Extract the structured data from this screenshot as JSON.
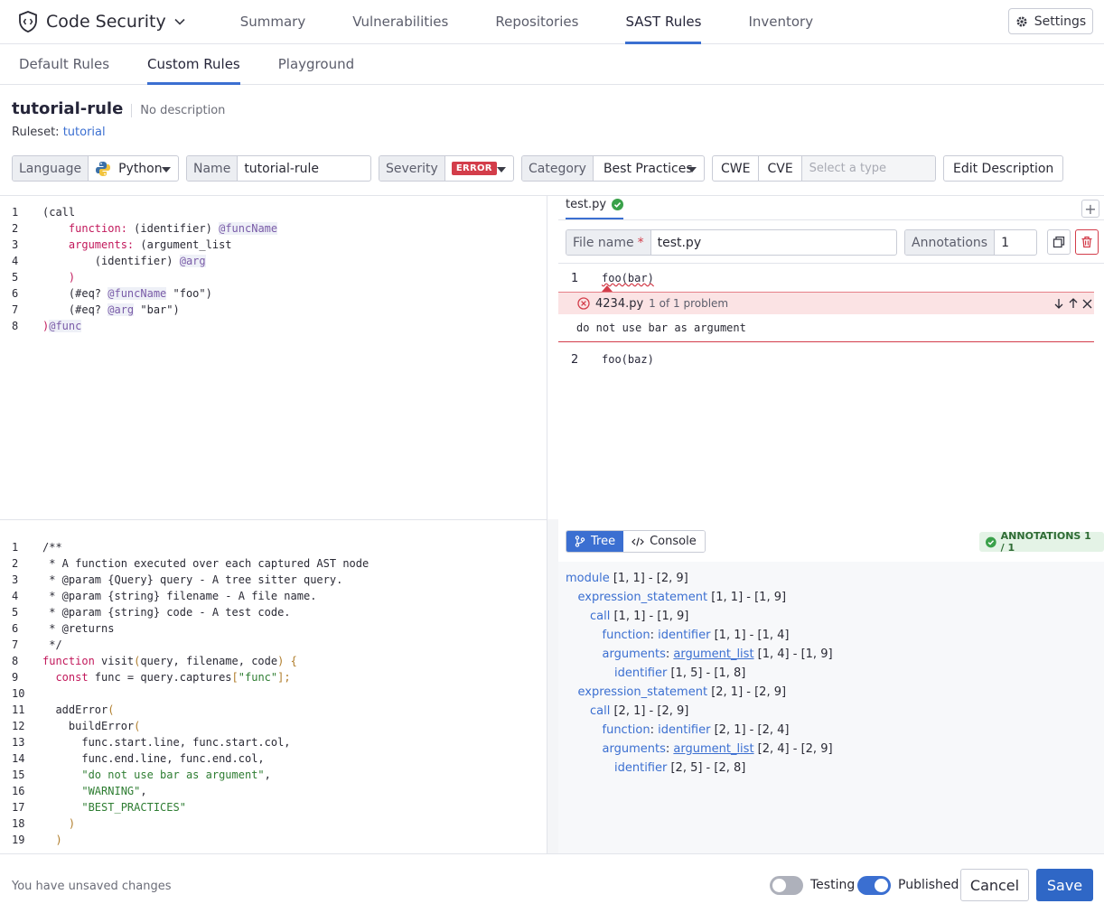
{
  "app": {
    "name": "Code Security",
    "settings_label": "Settings"
  },
  "nav": {
    "tabs": [
      "Summary",
      "Vulnerabilities",
      "Repositories",
      "SAST Rules",
      "Inventory"
    ],
    "active": "SAST Rules"
  },
  "subnav": {
    "tabs": [
      "Default Rules",
      "Custom Rules",
      "Playground"
    ],
    "active": "Custom Rules"
  },
  "rule": {
    "name": "tutorial-rule",
    "description": "No description",
    "ruleset_label": "Ruleset:",
    "ruleset": "tutorial"
  },
  "fields": {
    "language_label": "Language",
    "language": "Python",
    "name_label": "Name",
    "name": "tutorial-rule",
    "severity_label": "Severity",
    "severity": "ERROR",
    "category_label": "Category",
    "category": "Best Practices",
    "cwe": "CWE",
    "cve": "CVE",
    "type_placeholder": "Select a type",
    "edit_description": "Edit Description"
  },
  "query_editor": {
    "lines": [
      "1",
      "2",
      "3",
      "4",
      "5",
      "6",
      "7",
      "8"
    ]
  },
  "js_editor": {
    "lines": [
      "1",
      "2",
      "3",
      "4",
      "5",
      "6",
      "7",
      "8",
      "9",
      "10",
      "11",
      "12",
      "13",
      "14",
      "15",
      "16",
      "17",
      "18",
      "19"
    ]
  },
  "test_panel": {
    "file_tab": "test.py",
    "file_name_label": "File name",
    "required_mark": "*",
    "file_name": "test.py",
    "annotations_label": "Annotations",
    "annotations": "1",
    "code_line1_num": "1",
    "code_line1": "foo(bar)",
    "code_line2_num": "2",
    "code_line2": "foo(baz)",
    "problem_file": "4234.py",
    "problem_count": "1 of 1 problem",
    "problem_message": "do not use bar as argument"
  },
  "output_panel": {
    "tree_label": "Tree",
    "console_label": "Console",
    "annotations_badge": "ANNOTATIONS 1 / 1",
    "tree": [
      {
        "indent": 0,
        "field": "",
        "node": "module",
        "range": "[1, 1] - [2, 9]"
      },
      {
        "indent": 1,
        "field": "",
        "node": "expression_statement",
        "range": "[1, 1] - [1, 9]"
      },
      {
        "indent": 2,
        "field": "",
        "node": "call",
        "range": "[1, 1] - [1, 9]"
      },
      {
        "indent": 3,
        "field": "function",
        "node": "identifier",
        "range": "[1, 1] - [1, 4]"
      },
      {
        "indent": 3,
        "field": "arguments",
        "node": "argument_list",
        "range": "[1, 4] - [1, 9]"
      },
      {
        "indent": 4,
        "field": "",
        "node": "identifier",
        "range": "[1, 5] - [1, 8]"
      },
      {
        "indent": 1,
        "field": "",
        "node": "expression_statement",
        "range": "[2, 1] - [2, 9]"
      },
      {
        "indent": 2,
        "field": "",
        "node": "call",
        "range": "[2, 1] - [2, 9]"
      },
      {
        "indent": 3,
        "field": "function",
        "node": "identifier",
        "range": "[2, 1] - [2, 4]"
      },
      {
        "indent": 3,
        "field": "arguments",
        "node": "argument_list",
        "range": "[2, 4] - [2, 9]"
      },
      {
        "indent": 4,
        "field": "",
        "node": "identifier",
        "range": "[2, 5] - [2, 8]"
      }
    ]
  },
  "footer": {
    "unsaved": "You have unsaved changes",
    "testing_label": "Testing",
    "testing_on": false,
    "published_label": "Published",
    "published_on": true,
    "cancel": "Cancel",
    "save": "Save"
  },
  "colors": {
    "accent": "#3b6fd1",
    "error": "#d33d4a",
    "success": "#2e7d32"
  }
}
